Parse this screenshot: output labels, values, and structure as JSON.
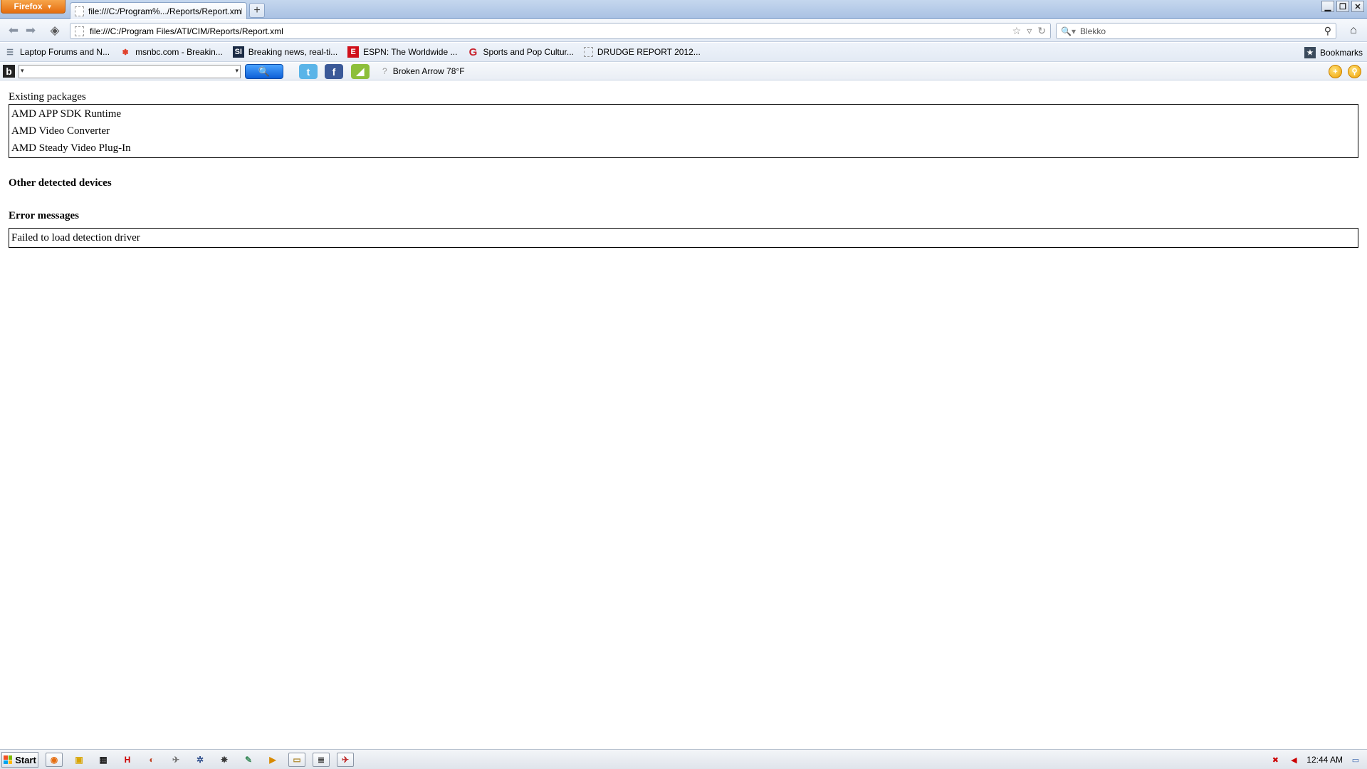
{
  "browser": {
    "app_button_label": "Firefox",
    "tab_title": "file:///C:/Program%.../Reports/Report.xml",
    "new_tab_label": "+",
    "url": "file:///C:/Program Files/ATI/CIM/Reports/Report.xml",
    "search_engine": "Blekko"
  },
  "bookmarks": {
    "items": [
      {
        "label": "Laptop Forums and N...",
        "icon": "forum-icon",
        "color": "#6c7a8a"
      },
      {
        "label": "msnbc.com - Breakin...",
        "icon": "nbc-peacock-icon",
        "color": "#e0402b"
      },
      {
        "label": "Breaking news, real-ti...",
        "icon": "si-icon",
        "color": "#1a2a44"
      },
      {
        "label": "ESPN: The Worldwide ...",
        "icon": "espn-icon",
        "color": "#d0101a"
      },
      {
        "label": "Sports and Pop Cultur...",
        "icon": "grantland-g-icon",
        "color": "#c8202a"
      },
      {
        "label": "DRUDGE REPORT 2012...",
        "icon": "page-icon",
        "color": "#ffffff"
      }
    ],
    "all_bookmarks_label": "Bookmarks"
  },
  "toolbar": {
    "logo_letter": "b",
    "weather_text": "Broken Arrow 78°F"
  },
  "report": {
    "existing_packages_label": "Existing packages",
    "packages": [
      "AMD APP SDK Runtime",
      "AMD Video Converter",
      "AMD Steady Video Plug-In"
    ],
    "other_devices_label": "Other detected devices",
    "error_messages_label": "Error messages",
    "errors": [
      "Failed to load detection driver"
    ]
  },
  "taskbar": {
    "start_label": "Start",
    "clock": "12:44 AM"
  }
}
